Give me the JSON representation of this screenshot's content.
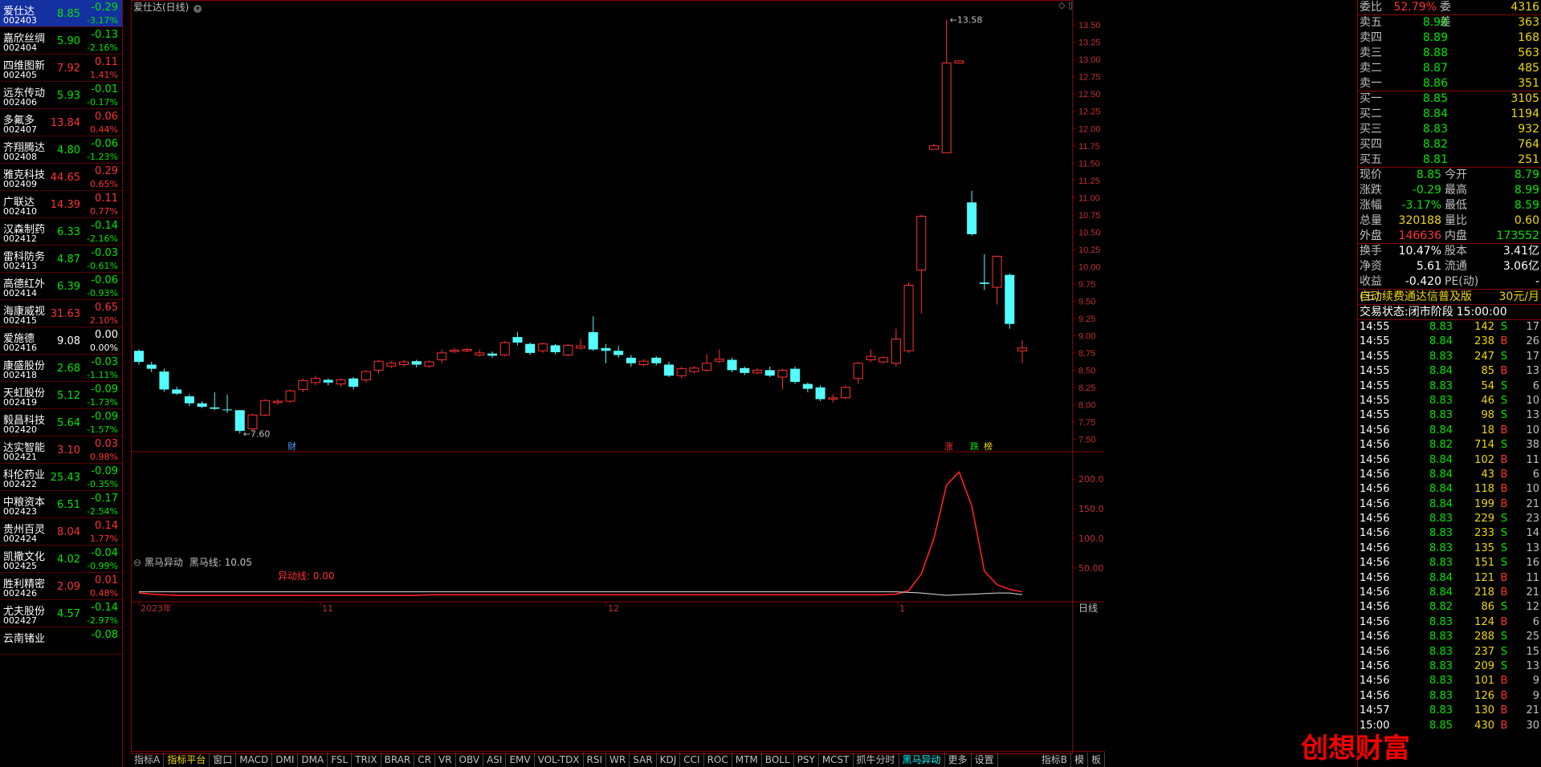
{
  "watchlist": [
    {
      "name": "爱仕达",
      "code": "002403",
      "price": "8.85",
      "chg": "-0.29",
      "pct": "-3.17%",
      "dir": "dn",
      "selected": true
    },
    {
      "name": "嘉欣丝绸",
      "code": "002404",
      "price": "5.90",
      "chg": "-0.13",
      "pct": "-2.16%",
      "dir": "dn"
    },
    {
      "name": "四维图新",
      "code": "002405",
      "price": "7.92",
      "chg": "0.11",
      "pct": "1.41%",
      "dir": "up"
    },
    {
      "name": "远东传动",
      "code": "002406",
      "price": "5.93",
      "chg": "-0.01",
      "pct": "-0.17%",
      "dir": "dn"
    },
    {
      "name": "多氟多",
      "code": "002407",
      "price": "13.84",
      "chg": "0.06",
      "pct": "0.44%",
      "dir": "up"
    },
    {
      "name": "齐翔腾达",
      "code": "002408",
      "price": "4.80",
      "chg": "-0.06",
      "pct": "-1.23%",
      "dir": "dn"
    },
    {
      "name": "雅克科技",
      "code": "002409",
      "price": "44.65",
      "chg": "0.29",
      "pct": "0.65%",
      "dir": "up"
    },
    {
      "name": "广联达",
      "code": "002410",
      "price": "14.39",
      "chg": "0.11",
      "pct": "0.77%",
      "dir": "up"
    },
    {
      "name": "汉森制药",
      "code": "002412",
      "price": "6.33",
      "chg": "-0.14",
      "pct": "-2.16%",
      "dir": "dn"
    },
    {
      "name": "雷科防务",
      "code": "002413",
      "price": "4.87",
      "chg": "-0.03",
      "pct": "-0.61%",
      "dir": "dn"
    },
    {
      "name": "高德红外",
      "code": "002414",
      "price": "6.39",
      "chg": "-0.06",
      "pct": "-0.93%",
      "dir": "dn"
    },
    {
      "name": "海康威视",
      "code": "002415",
      "price": "31.63",
      "chg": "0.65",
      "pct": "2.10%",
      "dir": "up"
    },
    {
      "name": "爱施德",
      "code": "002416",
      "price": "9.08",
      "chg": "0.00",
      "pct": "0.00%",
      "dir": "fl"
    },
    {
      "name": "康盛股份",
      "code": "002418",
      "price": "2.68",
      "chg": "-0.03",
      "pct": "-1.11%",
      "dir": "dn"
    },
    {
      "name": "天虹股份",
      "code": "002419",
      "price": "5.12",
      "chg": "-0.09",
      "pct": "-1.73%",
      "dir": "dn"
    },
    {
      "name": "毅昌科技",
      "code": "002420",
      "price": "5.64",
      "chg": "-0.09",
      "pct": "-1.57%",
      "dir": "dn"
    },
    {
      "name": "达实智能",
      "code": "002421",
      "price": "3.10",
      "chg": "0.03",
      "pct": "0.98%",
      "dir": "up"
    },
    {
      "name": "科伦药业",
      "code": "002422",
      "price": "25.43",
      "chg": "-0.09",
      "pct": "-0.35%",
      "dir": "dn"
    },
    {
      "name": "中粮资本",
      "code": "002423",
      "price": "6.51",
      "chg": "-0.17",
      "pct": "-2.54%",
      "dir": "dn"
    },
    {
      "name": "贵州百灵",
      "code": "002424",
      "price": "8.04",
      "chg": "0.14",
      "pct": "1.77%",
      "dir": "up"
    },
    {
      "name": "凯撒文化",
      "code": "002425",
      "price": "4.02",
      "chg": "-0.04",
      "pct": "-0.99%",
      "dir": "dn"
    },
    {
      "name": "胜利精密",
      "code": "002426",
      "price": "2.09",
      "chg": "0.01",
      "pct": "0.48%",
      "dir": "up"
    },
    {
      "name": "尤夫股份",
      "code": "002427",
      "price": "4.57",
      "chg": "-0.14",
      "pct": "-2.97%",
      "dir": "dn"
    },
    {
      "name": "云南锗业",
      "code": "",
      "price": "",
      "chg": "-0.08",
      "pct": "",
      "dir": "dn"
    }
  ],
  "chart": {
    "title": "爱仕达(日线)",
    "indicator_name": "黑马异动",
    "indicator_line1": "黑马线: 10.05",
    "indicator_line2": "异动线: 0.00",
    "high_label": "13.58",
    "low_label": "7.60",
    "marker_cai": "财",
    "marker_zhang": "涨",
    "marker_die": "跌",
    "marker_bang": "榜",
    "x_labels": [
      "2023年",
      "11",
      "12",
      "1"
    ],
    "y_labels": [
      "13.50",
      "13.25",
      "13.00",
      "12.75",
      "12.50",
      "12.25",
      "12.00",
      "11.75",
      "11.50",
      "11.25",
      "11.00",
      "10.75",
      "10.50",
      "10.25",
      "10.00",
      "9.75",
      "9.50",
      "9.25",
      "9.00",
      "8.75",
      "8.50",
      "8.25",
      "8.00",
      "7.75",
      "7.50"
    ],
    "ind_y_labels": [
      "200.0",
      "150.0",
      "100.0",
      "50.00"
    ],
    "period": "日线"
  },
  "chart_data": {
    "type": "candlestick",
    "title": "爱仕达(日线)",
    "ylim": [
      7.4,
      13.7
    ],
    "candles": [
      [
        8.78,
        8.62,
        8.8,
        8.58
      ],
      [
        8.58,
        8.52,
        8.62,
        8.47
      ],
      [
        8.48,
        8.22,
        8.52,
        8.19
      ],
      [
        8.22,
        8.16,
        8.26,
        8.14
      ],
      [
        8.12,
        8.02,
        8.15,
        7.98
      ],
      [
        8.02,
        7.97,
        8.05,
        7.95
      ],
      [
        7.96,
        7.94,
        8.18,
        7.92
      ],
      [
        7.93,
        7.92,
        8.15,
        7.88
      ],
      [
        7.92,
        7.62,
        7.92,
        7.58
      ],
      [
        7.65,
        7.85,
        7.87,
        7.62
      ],
      [
        7.85,
        8.06,
        8.08,
        7.83
      ],
      [
        8.03,
        8.05,
        8.08,
        8.0
      ],
      [
        8.05,
        8.2,
        8.22,
        8.03
      ],
      [
        8.22,
        8.35,
        8.38,
        8.18
      ],
      [
        8.32,
        8.38,
        8.42,
        8.28
      ],
      [
        8.36,
        8.32,
        8.38,
        8.28
      ],
      [
        8.3,
        8.36,
        8.38,
        8.26
      ],
      [
        8.38,
        8.26,
        8.4,
        8.22
      ],
      [
        8.36,
        8.48,
        8.5,
        8.32
      ],
      [
        8.5,
        8.63,
        8.65,
        8.45
      ],
      [
        8.56,
        8.6,
        8.63,
        8.53
      ],
      [
        8.58,
        8.62,
        8.65,
        8.55
      ],
      [
        8.63,
        8.58,
        8.65,
        8.54
      ],
      [
        8.56,
        8.62,
        8.64,
        8.53
      ],
      [
        8.65,
        8.75,
        8.8,
        8.6
      ],
      [
        8.77,
        8.79,
        8.82,
        8.75
      ],
      [
        8.78,
        8.8,
        8.82,
        8.76
      ],
      [
        8.72,
        8.75,
        8.8,
        8.7
      ],
      [
        8.74,
        8.71,
        8.77,
        8.68
      ],
      [
        8.72,
        8.9,
        8.92,
        8.7
      ],
      [
        8.98,
        8.9,
        9.05,
        8.86
      ],
      [
        8.88,
        8.75,
        8.9,
        8.72
      ],
      [
        8.78,
        8.88,
        8.9,
        8.75
      ],
      [
        8.86,
        8.76,
        8.88,
        8.73
      ],
      [
        8.72,
        8.86,
        8.88,
        8.7
      ],
      [
        8.82,
        8.85,
        8.95,
        8.8
      ],
      [
        9.05,
        8.8,
        9.28,
        8.78
      ],
      [
        8.82,
        8.78,
        8.88,
        8.6
      ],
      [
        8.78,
        8.72,
        8.85,
        8.68
      ],
      [
        8.68,
        8.6,
        8.72,
        8.55
      ],
      [
        8.58,
        8.63,
        8.66,
        8.55
      ],
      [
        8.68,
        8.6,
        8.7,
        8.57
      ],
      [
        8.58,
        8.42,
        8.62,
        8.4
      ],
      [
        8.42,
        8.52,
        8.55,
        8.38
      ],
      [
        8.48,
        8.53,
        8.56,
        8.45
      ],
      [
        8.5,
        8.6,
        8.73,
        8.48
      ],
      [
        8.63,
        8.66,
        8.8,
        8.6
      ],
      [
        8.65,
        8.5,
        8.68,
        8.47
      ],
      [
        8.53,
        8.46,
        8.55,
        8.43
      ],
      [
        8.46,
        8.5,
        8.53,
        8.44
      ],
      [
        8.5,
        8.42,
        8.55,
        8.4
      ],
      [
        8.4,
        8.5,
        8.52,
        8.22
      ],
      [
        8.52,
        8.33,
        8.55,
        8.3
      ],
      [
        8.3,
        8.23,
        8.32,
        8.18
      ],
      [
        8.25,
        8.08,
        8.28,
        8.05
      ],
      [
        8.08,
        8.1,
        8.15,
        8.03
      ],
      [
        8.1,
        8.25,
        8.28,
        8.08
      ],
      [
        8.38,
        8.6,
        8.62,
        8.3
      ],
      [
        8.65,
        8.7,
        8.8,
        8.62
      ],
      [
        8.62,
        8.68,
        8.7,
        8.6
      ],
      [
        8.6,
        8.95,
        9.1,
        8.55
      ],
      [
        8.78,
        9.73,
        9.77,
        8.75
      ],
      [
        9.95,
        10.73,
        10.75,
        9.32
      ],
      [
        11.7,
        11.75,
        11.78,
        11.7
      ],
      [
        11.65,
        12.95,
        13.58,
        11.65
      ],
      [
        12.95,
        12.98,
        12.98,
        12.95
      ],
      [
        10.93,
        10.47,
        11.1,
        10.45
      ],
      [
        9.77,
        9.75,
        10.18,
        9.66
      ],
      [
        9.7,
        10.15,
        10.16,
        9.45
      ],
      [
        9.88,
        9.17,
        9.9,
        9.1
      ],
      [
        8.78,
        8.82,
        8.93,
        8.6
      ]
    ],
    "indicator": {
      "name": "黑马异动",
      "ylim": [
        0,
        230
      ],
      "heima": [
        8,
        6,
        5,
        4,
        4,
        4,
        4,
        4,
        4,
        4,
        4,
        4,
        4,
        4,
        4,
        4,
        4,
        4,
        4,
        4,
        4,
        4,
        4,
        5,
        5,
        5,
        5,
        5,
        5,
        5,
        5,
        5,
        5,
        5,
        5,
        5,
        5,
        5,
        5,
        5,
        5,
        5,
        5,
        5,
        5,
        5,
        5,
        5,
        5,
        5,
        5,
        5,
        5,
        5,
        5,
        5,
        5,
        5,
        5,
        5,
        6,
        12,
        40,
        100,
        190,
        212,
        155,
        45,
        22,
        14,
        10
      ],
      "white": [
        10,
        10,
        10,
        10,
        10,
        10,
        10,
        10,
        10,
        10,
        10,
        10,
        10,
        10,
        10,
        10,
        10,
        10,
        10,
        10,
        10,
        10,
        10,
        10,
        10,
        10,
        10,
        10,
        10,
        10,
        10,
        10,
        10,
        10,
        10,
        10,
        10,
        10,
        10,
        10,
        10,
        10,
        10,
        10,
        10,
        10,
        10,
        10,
        10,
        10,
        10,
        10,
        10,
        10,
        10,
        10,
        10,
        10,
        10,
        10,
        10,
        9,
        8,
        6,
        4,
        5,
        6,
        7,
        8,
        8,
        5
      ]
    }
  },
  "tabs": [
    "指标A",
    "指标平台",
    "窗口",
    "MACD",
    "DMI",
    "DMA",
    "FSL",
    "TRIX",
    "BRAR",
    "CR",
    "VR",
    "OBV",
    "ASI",
    "EMV",
    "VOL-TDX",
    "RSI",
    "WR",
    "SAR",
    "KDJ",
    "CCI",
    "ROC",
    "MTM",
    "BOLL",
    "PSY",
    "MCST",
    "抓牛分时",
    "黑马异动",
    "更多",
    "设置"
  ],
  "tabs_right": [
    "指标B",
    "模",
    "板"
  ],
  "right_panel": {
    "weibi_label": "委比",
    "weibi_val": "52.79%",
    "weicha_label": "委差",
    "weicha_val": "4316",
    "sell": [
      {
        "l": "卖五",
        "p": "8.90",
        "v": "363"
      },
      {
        "l": "卖四",
        "p": "8.89",
        "v": "168"
      },
      {
        "l": "卖三",
        "p": "8.88",
        "v": "563"
      },
      {
        "l": "卖二",
        "p": "8.87",
        "v": "485"
      },
      {
        "l": "卖一",
        "p": "8.86",
        "v": "351"
      }
    ],
    "buy": [
      {
        "l": "买一",
        "p": "8.85",
        "v": "3105"
      },
      {
        "l": "买二",
        "p": "8.84",
        "v": "1194"
      },
      {
        "l": "买三",
        "p": "8.83",
        "v": "932"
      },
      {
        "l": "买四",
        "p": "8.82",
        "v": "764"
      },
      {
        "l": "买五",
        "p": "8.81",
        "v": "251"
      }
    ],
    "quote": [
      {
        "a": "现价",
        "b": "8.85",
        "bc": "dn",
        "c": "今开",
        "d": "8.79",
        "dc": "dn"
      },
      {
        "a": "涨跌",
        "b": "-0.29",
        "bc": "dn",
        "c": "最高",
        "d": "8.99",
        "dc": "dn"
      },
      {
        "a": "涨幅",
        "b": "-3.17%",
        "bc": "dn",
        "c": "最低",
        "d": "8.59",
        "dc": "dn"
      },
      {
        "a": "总量",
        "b": "320188",
        "bc": "yel",
        "c": "量比",
        "d": "0.60",
        "dc": "yel"
      },
      {
        "a": "外盘",
        "b": "146636",
        "bc": "up",
        "c": "内盘",
        "d": "173552",
        "dc": "dn"
      },
      {
        "a": "换手",
        "b": "10.47%",
        "bc": "fl",
        "c": "股本",
        "d": "3.41亿",
        "dc": "fl"
      },
      {
        "a": "净资",
        "b": "5.61",
        "bc": "fl",
        "c": "流通",
        "d": "3.06亿",
        "dc": "fl"
      },
      {
        "a": "收益(三)",
        "b": "-0.420",
        "bc": "fl",
        "c": "PE(动)",
        "d": "-",
        "dc": "fl"
      }
    ],
    "ad": "自动续费通达信普及版",
    "ad_price": "30元/月",
    "status_label": "交易状态:",
    "status": "闭市阶段",
    "status_time": "15:00:00",
    "ticks": [
      {
        "t": "14:55",
        "p": "8.83",
        "v": "142",
        "f": "S",
        "n": "17",
        "pc": "dn",
        "vc": "yel"
      },
      {
        "t": "14:55",
        "p": "8.84",
        "v": "238",
        "f": "B",
        "n": "26",
        "pc": "dn",
        "vc": "yel"
      },
      {
        "t": "14:55",
        "p": "8.83",
        "v": "247",
        "f": "S",
        "n": "17",
        "pc": "dn",
        "vc": "yel"
      },
      {
        "t": "14:55",
        "p": "8.84",
        "v": "85",
        "f": "B",
        "n": "13",
        "pc": "dn",
        "vc": "yel"
      },
      {
        "t": "14:55",
        "p": "8.83",
        "v": "54",
        "f": "S",
        "n": "6",
        "pc": "dn",
        "vc": "yel"
      },
      {
        "t": "14:55",
        "p": "8.83",
        "v": "46",
        "f": "S",
        "n": "10",
        "pc": "dn",
        "vc": "yel"
      },
      {
        "t": "14:55",
        "p": "8.83",
        "v": "98",
        "f": "S",
        "n": "13",
        "pc": "dn",
        "vc": "yel"
      },
      {
        "t": "14:56",
        "p": "8.84",
        "v": "18",
        "f": "B",
        "n": "10",
        "pc": "dn",
        "vc": "yel"
      },
      {
        "t": "14:56",
        "p": "8.82",
        "v": "714",
        "f": "S",
        "n": "38",
        "pc": "dn",
        "vc": "mag"
      },
      {
        "t": "14:56",
        "p": "8.84",
        "v": "102",
        "f": "B",
        "n": "11",
        "pc": "dn",
        "vc": "yel"
      },
      {
        "t": "14:56",
        "p": "8.84",
        "v": "43",
        "f": "B",
        "n": "6",
        "pc": "dn",
        "vc": "yel"
      },
      {
        "t": "14:56",
        "p": "8.84",
        "v": "118",
        "f": "B",
        "n": "10",
        "pc": "dn",
        "vc": "yel"
      },
      {
        "t": "14:56",
        "p": "8.84",
        "v": "199",
        "f": "B",
        "n": "21",
        "pc": "dn",
        "vc": "yel"
      },
      {
        "t": "14:56",
        "p": "8.83",
        "v": "229",
        "f": "S",
        "n": "23",
        "pc": "dn",
        "vc": "yel"
      },
      {
        "t": "14:56",
        "p": "8.83",
        "v": "233",
        "f": "S",
        "n": "14",
        "pc": "dn",
        "vc": "yel"
      },
      {
        "t": "14:56",
        "p": "8.83",
        "v": "135",
        "f": "S",
        "n": "13",
        "pc": "dn",
        "vc": "yel"
      },
      {
        "t": "14:56",
        "p": "8.83",
        "v": "151",
        "f": "S",
        "n": "16",
        "pc": "dn",
        "vc": "yel"
      },
      {
        "t": "14:56",
        "p": "8.84",
        "v": "121",
        "f": "B",
        "n": "11",
        "pc": "dn",
        "vc": "yel"
      },
      {
        "t": "14:56",
        "p": "8.84",
        "v": "218",
        "f": "B",
        "n": "21",
        "pc": "dn",
        "vc": "yel"
      },
      {
        "t": "14:56",
        "p": "8.82",
        "v": "86",
        "f": "S",
        "n": "12",
        "pc": "dn",
        "vc": "yel"
      },
      {
        "t": "14:56",
        "p": "8.83",
        "v": "124",
        "f": "B",
        "n": "6",
        "pc": "dn",
        "vc": "yel"
      },
      {
        "t": "14:56",
        "p": "8.83",
        "v": "288",
        "f": "S",
        "n": "25",
        "pc": "dn",
        "vc": "yel"
      },
      {
        "t": "14:56",
        "p": "8.83",
        "v": "237",
        "f": "S",
        "n": "15",
        "pc": "dn",
        "vc": "yel"
      },
      {
        "t": "14:56",
        "p": "8.83",
        "v": "209",
        "f": "S",
        "n": "13",
        "pc": "dn",
        "vc": "yel"
      },
      {
        "t": "14:56",
        "p": "8.83",
        "v": "101",
        "f": "B",
        "n": "9",
        "pc": "dn",
        "vc": "yel"
      },
      {
        "t": "14:56",
        "p": "8.83",
        "v": "126",
        "f": "B",
        "n": "9",
        "pc": "dn",
        "vc": "yel"
      },
      {
        "t": "14:57",
        "p": "8.83",
        "v": "130",
        "f": "B",
        "n": "21",
        "pc": "dn",
        "vc": "yel"
      },
      {
        "t": "15:00",
        "p": "8.85",
        "v": "430",
        "f": "B",
        "n": "30",
        "pc": "dn",
        "vc": "yel"
      }
    ],
    "bottom_tabs": [
      "日线",
      "-"
    ]
  },
  "watermark": "创想财富"
}
